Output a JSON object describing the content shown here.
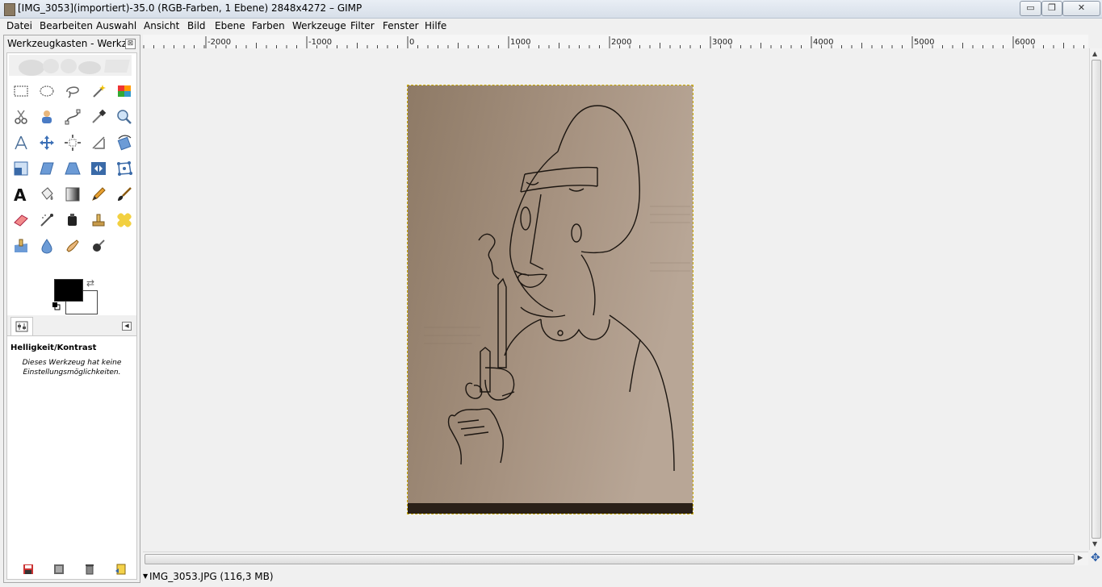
{
  "window": {
    "title": "[IMG_3053](importiert)-35.0 (RGB-Farben, 1 Ebene) 2848x4272 – GIMP",
    "minimize_label": "▭",
    "maximize_label": "❐",
    "close_label": "✕"
  },
  "menu": {
    "items": [
      "Datei",
      "Bearbeiten",
      "Auswahl",
      "Ansicht",
      "Bild",
      "Ebene",
      "Farben",
      "Werkzeuge",
      "Filter",
      "Fenster",
      "Hilfe"
    ]
  },
  "toolbox": {
    "title": "Werkzeugkasten - Werkz...",
    "close_label": "⊠",
    "active_tool": "Helligkeit/Kontrast",
    "tool_description": "Dieses Werkzeug hat keine Einstellungsmöglichkeiten.",
    "foreground_color": "#000000",
    "background_color": "#ffffff"
  },
  "ruler": {
    "ticks": [
      "-2000",
      "-1000",
      "0",
      "1000",
      "2000",
      "3000",
      "4000",
      "5000",
      "6000"
    ]
  },
  "status": {
    "file_info": "IMG_3053.JPG (116,3 MB)"
  }
}
